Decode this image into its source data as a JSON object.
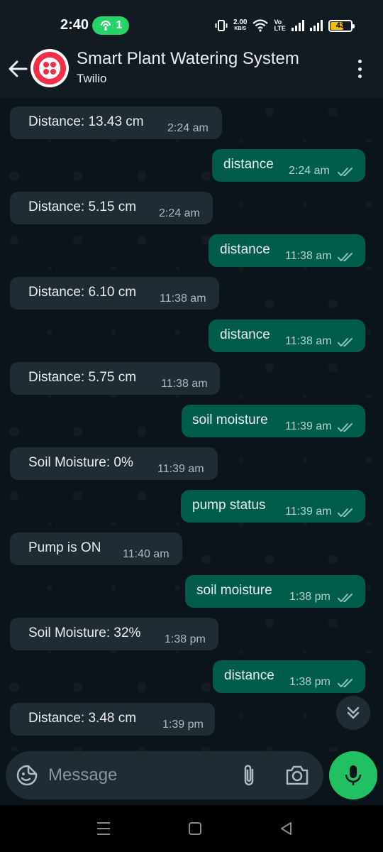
{
  "status_bar": {
    "time": "2:40",
    "hotspot_count": "1",
    "net_speed_value": "2.00",
    "net_speed_unit": "KB/S",
    "volte_top": "Vo",
    "volte_bottom": "LTE",
    "battery": "43"
  },
  "header": {
    "title": "Smart Plant Watering System",
    "subtitle": "Twilio"
  },
  "messages": [
    {
      "dir": "in",
      "text": "Distance: 13.43 cm",
      "time": "2:24 am"
    },
    {
      "dir": "out",
      "text": "distance",
      "time": "2:24 am"
    },
    {
      "dir": "in",
      "text": "Distance: 5.15 cm",
      "time": "2:24 am"
    },
    {
      "dir": "out",
      "text": "distance",
      "time": "11:38 am"
    },
    {
      "dir": "in",
      "text": "Distance: 6.10 cm",
      "time": "11:38 am"
    },
    {
      "dir": "out",
      "text": "distance",
      "time": "11:38 am"
    },
    {
      "dir": "in",
      "text": "Distance: 5.75 cm",
      "time": "11:38 am"
    },
    {
      "dir": "out",
      "text": "soil moisture",
      "time": "11:39 am"
    },
    {
      "dir": "in",
      "text": "Soil Moisture: 0%",
      "time": "11:39 am"
    },
    {
      "dir": "out",
      "text": "pump status",
      "time": "11:39 am"
    },
    {
      "dir": "in",
      "text": "Pump is ON",
      "time": "11:40 am"
    },
    {
      "dir": "out",
      "text": "soil moisture",
      "time": "1:38 pm"
    },
    {
      "dir": "in",
      "text": "Soil Moisture: 32%",
      "time": "1:38 pm"
    },
    {
      "dir": "out",
      "text": "distance",
      "time": "1:38 pm"
    },
    {
      "dir": "in",
      "text": "Distance: 3.48 cm",
      "time": "1:39 pm"
    }
  ],
  "composer": {
    "placeholder": "Message"
  },
  "colors": {
    "incoming_bubble": "#202c33",
    "outgoing_bubble": "#005c4b",
    "read_ticks": "#8ac3b8",
    "accent_green": "#21c063",
    "brand_red": "#f22f46"
  }
}
